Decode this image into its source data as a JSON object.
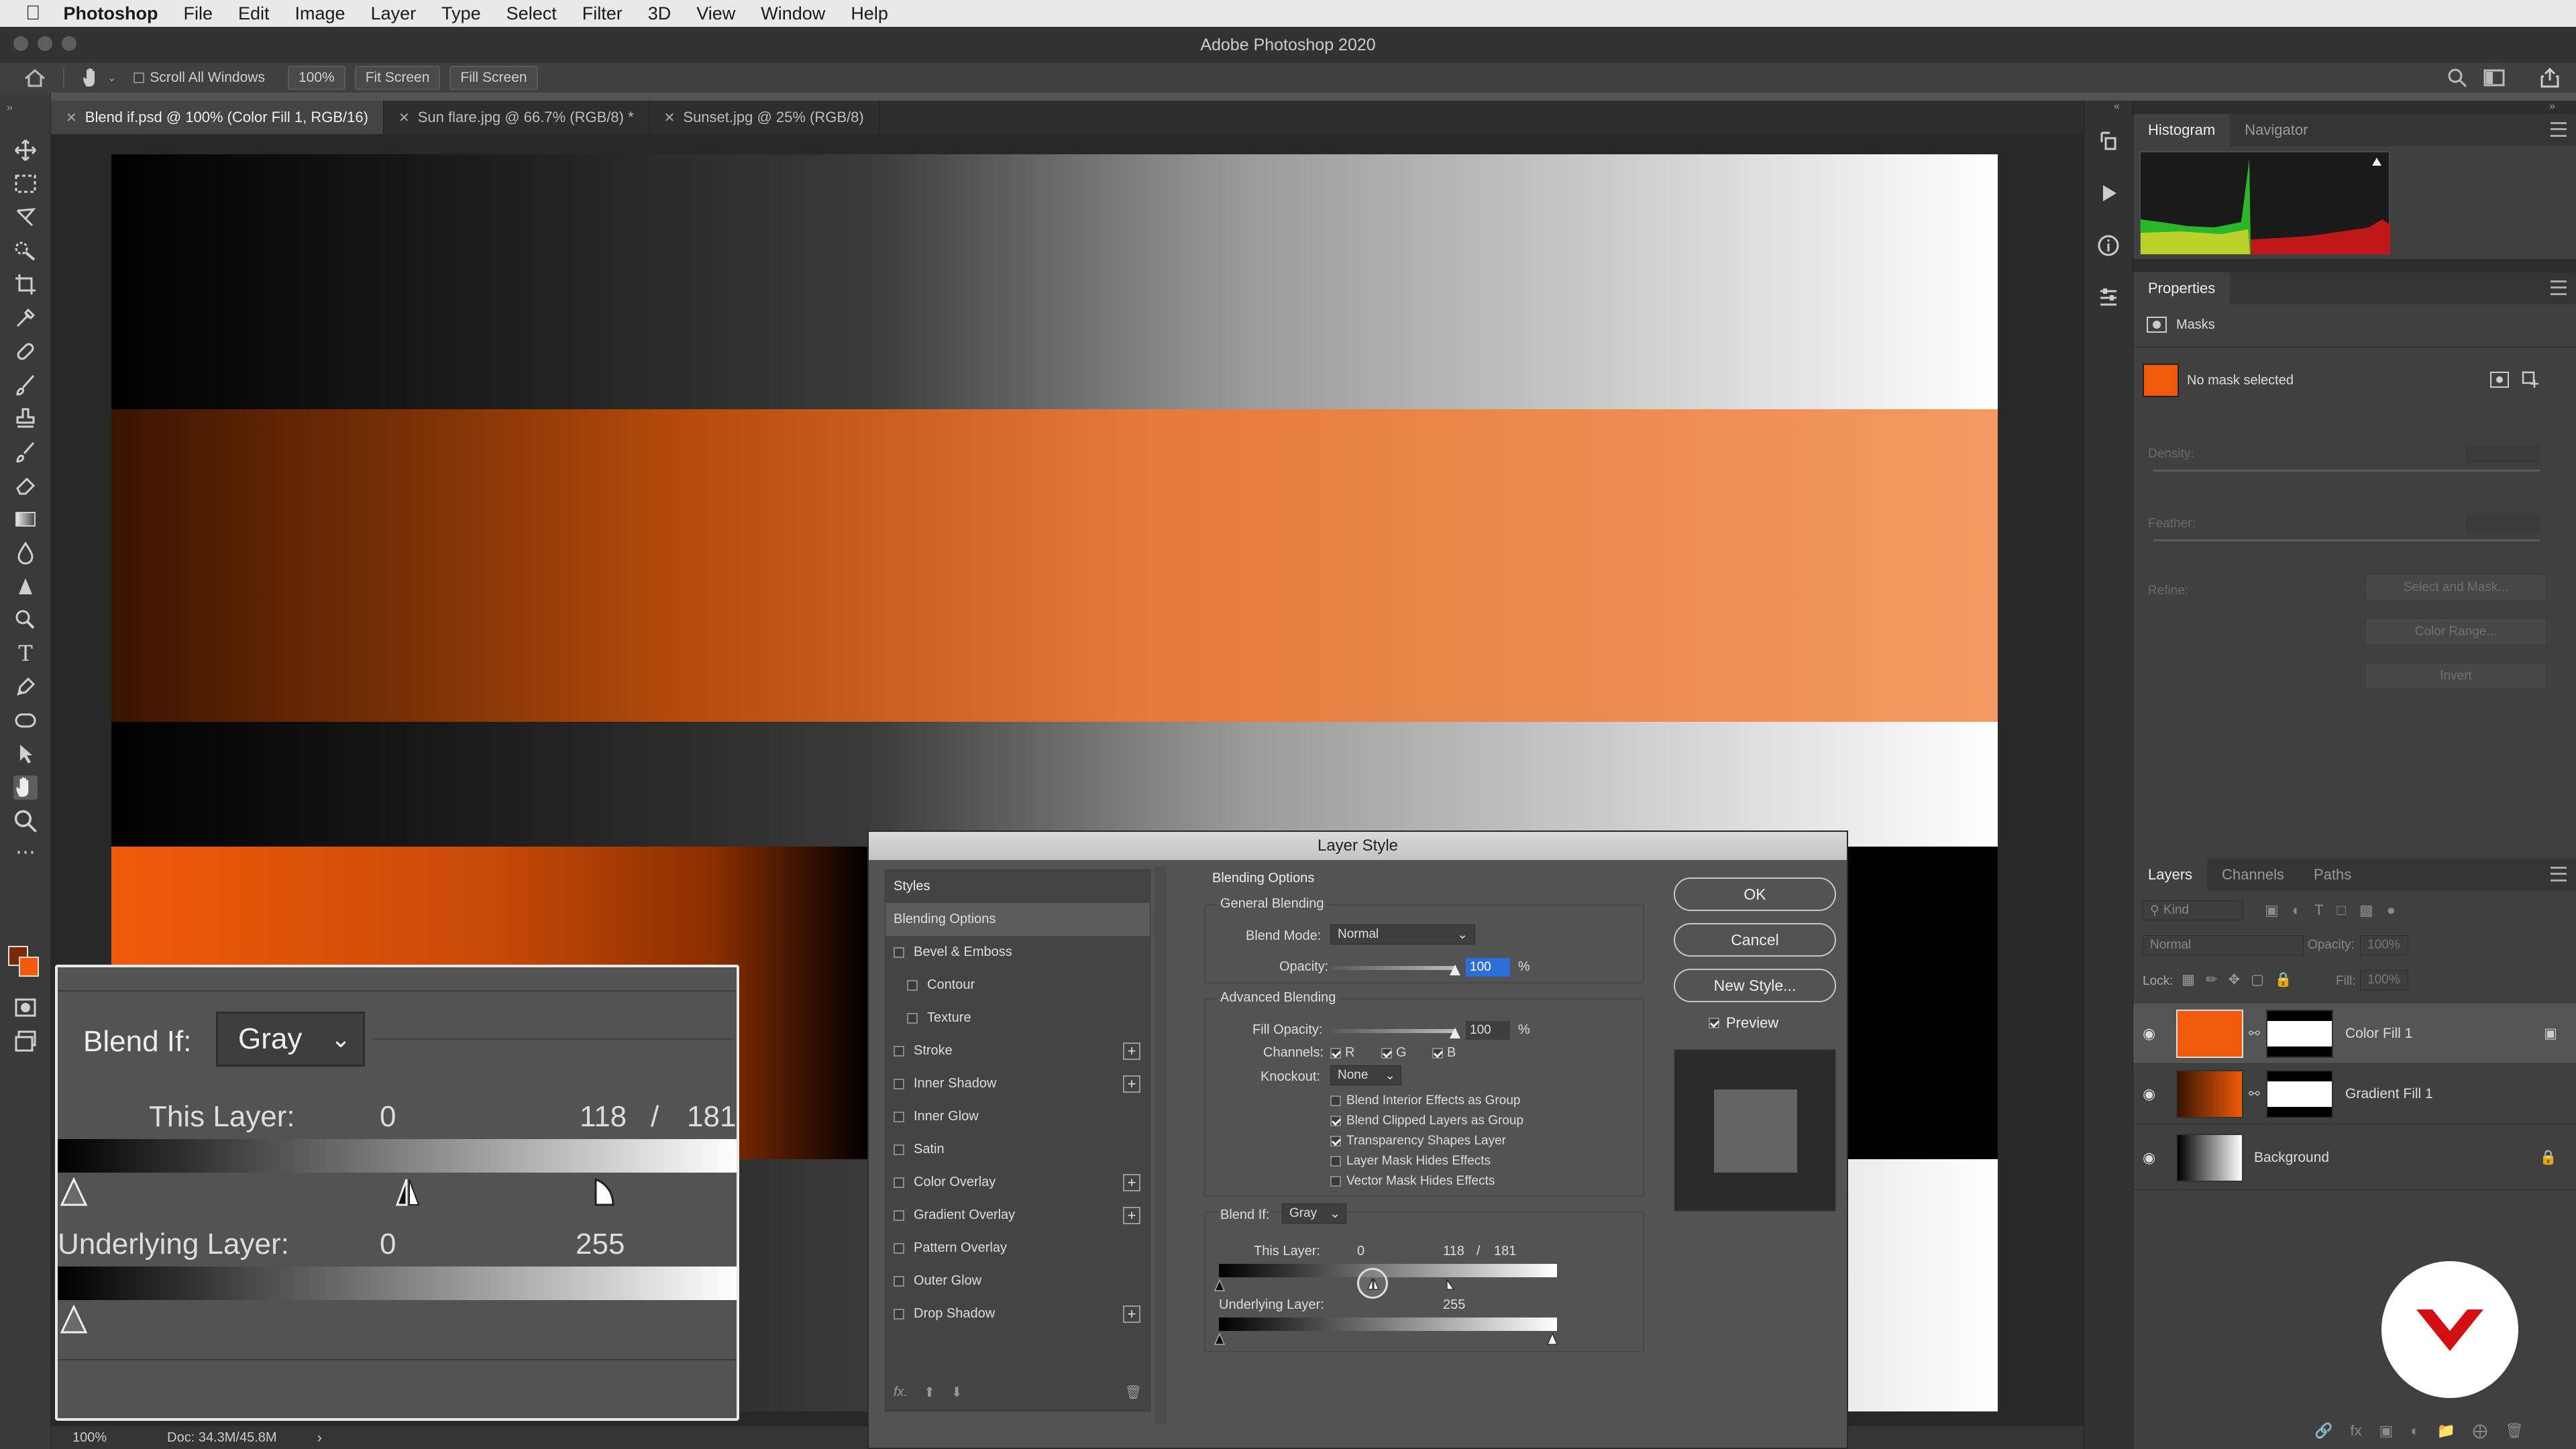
{
  "menubar": {
    "app_name": "Photoshop",
    "items": [
      "File",
      "Edit",
      "Image",
      "Layer",
      "Type",
      "Select",
      "Filter",
      "3D",
      "View",
      "Window",
      "Help"
    ]
  },
  "window": {
    "title": "Adobe Photoshop 2020"
  },
  "options_bar": {
    "scroll_all_windows": "Scroll All Windows",
    "zoom": "100%",
    "fit_screen": "Fit Screen",
    "fill_screen": "Fill Screen"
  },
  "tabs": [
    {
      "label": "Blend if.psd @ 100% (Color Fill 1, RGB/16)",
      "active": true
    },
    {
      "label": "Sun flare.jpg @ 66.7% (RGB/8) *",
      "active": false
    },
    {
      "label": "Sunset.jpg @ 25% (RGB/8)",
      "active": false
    }
  ],
  "status": {
    "zoom": "100%",
    "doc": "Doc: 34.3M/45.8M"
  },
  "histogram": {
    "tabs": [
      "Histogram",
      "Navigator"
    ]
  },
  "properties": {
    "title": "Properties",
    "masks_label": "Masks",
    "no_mask": "No mask selected",
    "density": "Density:",
    "feather": "Feather:",
    "refine": "Refine:",
    "select_and_mask": "Select and Mask...",
    "color_range": "Color Range...",
    "invert": "Invert"
  },
  "layers": {
    "tabs": [
      "Layers",
      "Channels",
      "Paths"
    ],
    "kind": "Kind",
    "blend_mode": "Normal",
    "opacity_label": "Opacity:",
    "opacity_value": "100%",
    "lock_label": "Lock:",
    "fill_label": "Fill:",
    "fill_value": "100%",
    "items": [
      {
        "name": "Color Fill 1"
      },
      {
        "name": "Gradient Fill 1"
      },
      {
        "name": "Background"
      }
    ]
  },
  "dialog": {
    "title": "Layer Style",
    "styles_header": "Styles",
    "styles": [
      {
        "label": "Blending Options",
        "selected": true,
        "checkbox": false,
        "plus": false,
        "indent": false
      },
      {
        "label": "Bevel & Emboss",
        "checkbox": true,
        "plus": false,
        "indent": false
      },
      {
        "label": "Contour",
        "checkbox": true,
        "plus": false,
        "indent": true
      },
      {
        "label": "Texture",
        "checkbox": true,
        "plus": false,
        "indent": true
      },
      {
        "label": "Stroke",
        "checkbox": true,
        "plus": true,
        "indent": false
      },
      {
        "label": "Inner Shadow",
        "checkbox": true,
        "plus": true,
        "indent": false
      },
      {
        "label": "Inner Glow",
        "checkbox": true,
        "plus": false,
        "indent": false
      },
      {
        "label": "Satin",
        "checkbox": true,
        "plus": false,
        "indent": false
      },
      {
        "label": "Color Overlay",
        "checkbox": true,
        "plus": true,
        "indent": false
      },
      {
        "label": "Gradient Overlay",
        "checkbox": true,
        "plus": true,
        "indent": false
      },
      {
        "label": "Pattern Overlay",
        "checkbox": true,
        "plus": false,
        "indent": false
      },
      {
        "label": "Outer Glow",
        "checkbox": true,
        "plus": false,
        "indent": false
      },
      {
        "label": "Drop Shadow",
        "checkbox": true,
        "plus": true,
        "indent": false
      }
    ],
    "fx": "fx.",
    "blending_options": "Blending Options",
    "general_blending": "General Blending",
    "blend_mode_label": "Blend Mode:",
    "blend_mode_value": "Normal",
    "opacity_label": "Opacity:",
    "opacity_value": "100",
    "percent": "%",
    "advanced_blending": "Advanced Blending",
    "fill_opacity_label": "Fill Opacity:",
    "fill_opacity_value": "100",
    "channels_label": "Channels:",
    "channels": [
      "R",
      "G",
      "B"
    ],
    "knockout_label": "Knockout:",
    "knockout_value": "None",
    "options": [
      {
        "label": "Blend Interior Effects as Group",
        "checked": false
      },
      {
        "label": "Blend Clipped Layers as Group",
        "checked": true
      },
      {
        "label": "Transparency Shapes Layer",
        "checked": true
      },
      {
        "label": "Layer Mask Hides Effects",
        "checked": false
      },
      {
        "label": "Vector Mask Hides Effects",
        "checked": false
      }
    ],
    "blend_if_label": "Blend If:",
    "blend_if_value": "Gray",
    "this_layer_label": "This Layer:",
    "this_layer_black": "0",
    "this_layer_white_a": "118",
    "slash": "/",
    "this_layer_white_b": "181",
    "underlying_label": "Underlying Layer:",
    "underlying_black": "0",
    "underlying_white": "255",
    "ok": "OK",
    "cancel": "Cancel",
    "new_style": "New Style...",
    "preview": "Preview"
  },
  "colors": {
    "orange": "#f05a0a",
    "accent_blue": "#2a6fd6",
    "brand_red": "#d40f14"
  }
}
